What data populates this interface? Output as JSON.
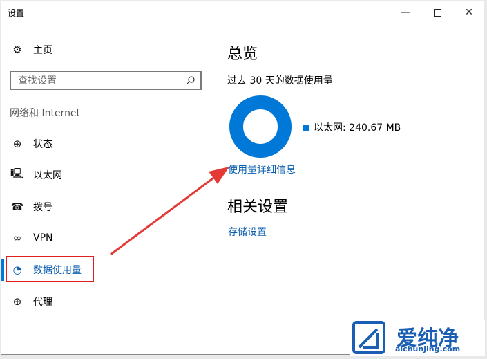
{
  "window": {
    "title": "设置"
  },
  "sidebar": {
    "home_label": "主页",
    "search_placeholder": "查找设置",
    "section_title": "网络和 Internet",
    "items": [
      {
        "label": "状态",
        "icon": "globe-icon"
      },
      {
        "label": "以太网",
        "icon": "ethernet-icon"
      },
      {
        "label": "拨号",
        "icon": "dialup-icon"
      },
      {
        "label": "VPN",
        "icon": "vpn-icon"
      },
      {
        "label": "数据使用量",
        "icon": "pie-icon",
        "selected": true
      },
      {
        "label": "代理",
        "icon": "globe-icon"
      }
    ]
  },
  "main": {
    "title": "总览",
    "subtitle": "过去 30 天的数据使用量",
    "legend": "以太网: 240.67 MB",
    "details_link": "使用量详细信息",
    "related_title": "相关设置",
    "storage_link": "存储设置"
  },
  "chart_data": {
    "type": "pie",
    "categories": [
      "以太网"
    ],
    "values": [
      240.67
    ],
    "colors": [
      "#0078d7"
    ]
  },
  "watermark": {
    "brand": "爱纯净",
    "url": "aichunjing.com"
  },
  "colors": {
    "accent": "#0078d7",
    "link": "#0a5eae",
    "highlight": "#e02020"
  }
}
